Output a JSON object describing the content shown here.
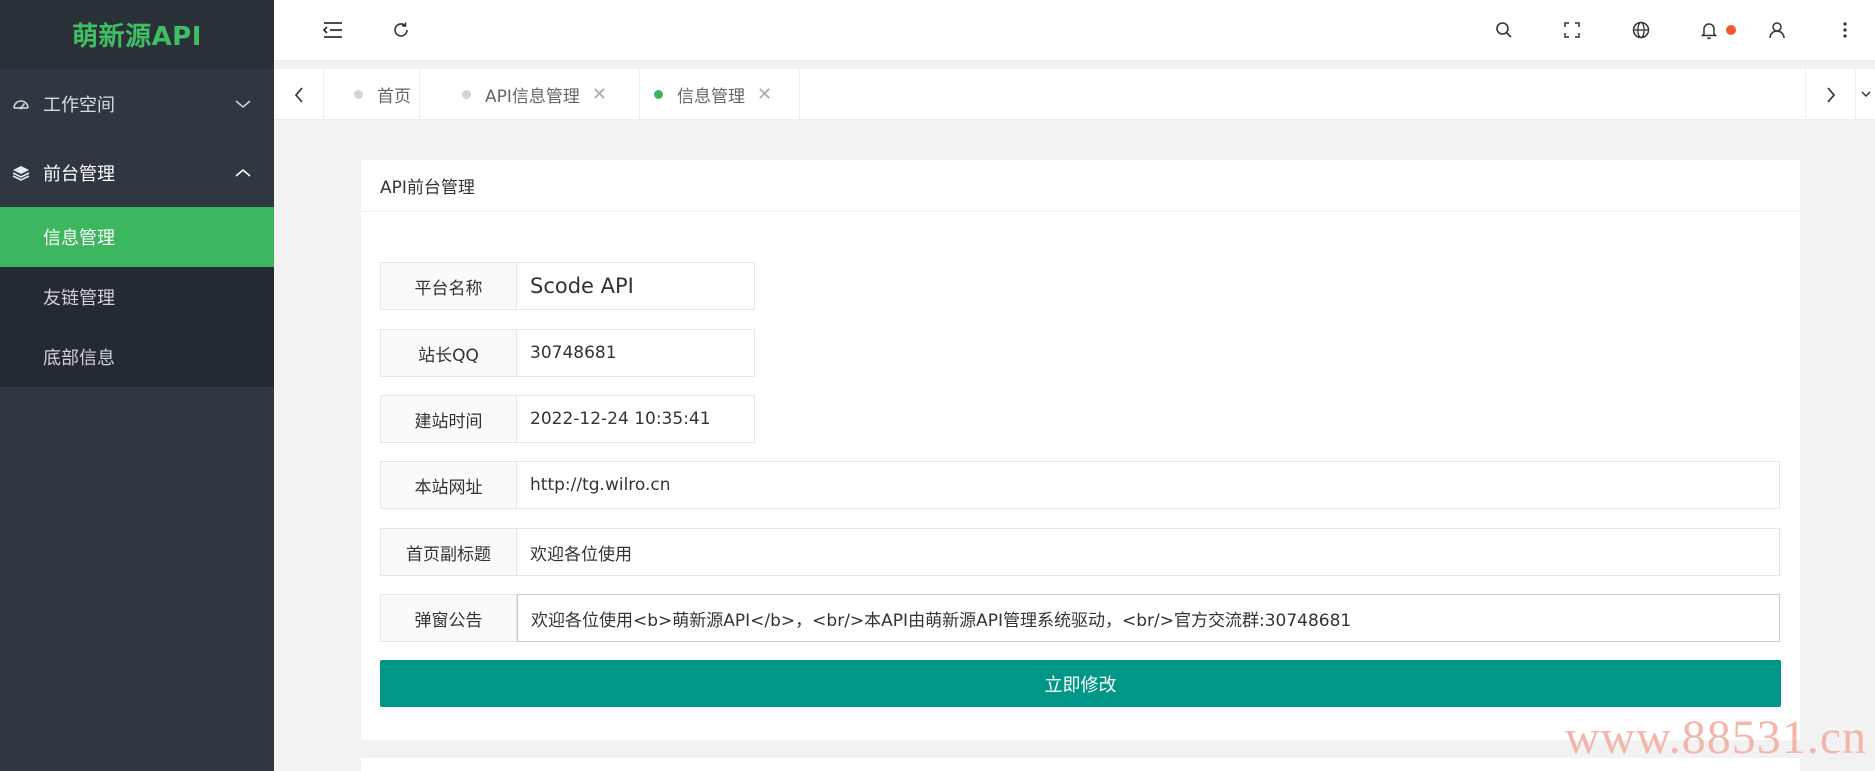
{
  "sidebar": {
    "logo": "萌新源API",
    "groups": [
      {
        "label": "工作空间",
        "icon": "dashboard-icon",
        "expanded": false
      },
      {
        "label": "前台管理",
        "icon": "layers-icon",
        "expanded": true
      }
    ],
    "items": [
      {
        "label": "信息管理",
        "active": true
      },
      {
        "label": "友链管理",
        "active": false
      },
      {
        "label": "底部信息",
        "active": false
      }
    ]
  },
  "header": {
    "icons": [
      "menu-fold-icon",
      "refresh-icon",
      "search-icon",
      "fullscreen-icon",
      "globe-icon",
      "bell-icon",
      "user-icon",
      "more-icon"
    ]
  },
  "tabs": [
    {
      "label": "首页",
      "closable": false,
      "active": false
    },
    {
      "label": "API信息管理",
      "closable": true,
      "active": false
    },
    {
      "label": "信息管理",
      "closable": true,
      "active": true
    }
  ],
  "tab_close_glyph": "✕",
  "card": {
    "title": "API前台管理",
    "fields": [
      {
        "label": "平台名称",
        "value": "Scode API"
      },
      {
        "label": "站长QQ",
        "value": "30748681"
      },
      {
        "label": "建站时间",
        "value": "2022-12-24 10:35:41"
      },
      {
        "label": "本站网址",
        "value": "http://tg.wilro.cn"
      },
      {
        "label": "首页副标题",
        "value": "欢迎各位使用"
      },
      {
        "label": "弹窗公告",
        "value": "欢迎各位使用<b>萌新源API</b>，<br/>本API由萌新源API管理系统驱动，<br/>官方交流群:30748681"
      }
    ],
    "submit_label": "立即修改"
  },
  "watermark": "www.88531.cn",
  "colors": {
    "sidebar_bg": "#2f3740",
    "logo_green": "#3fbf61",
    "active_green": "#3cb75f",
    "submit_teal": "#009688",
    "notify_dot": "#f05a28"
  }
}
